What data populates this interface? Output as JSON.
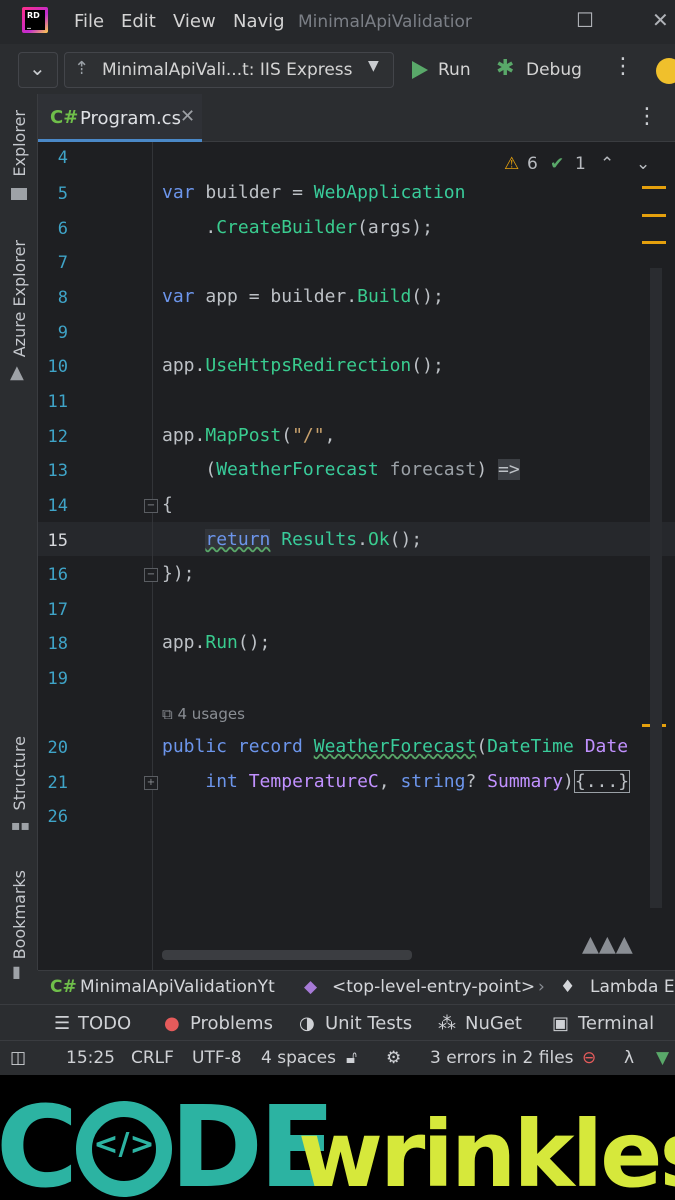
{
  "menu": {
    "file": "File",
    "edit": "Edit",
    "view": "View",
    "navigate": "Navig",
    "window_title": "MinimalApiValidatior"
  },
  "toolbar": {
    "config": "MinimalApiVali...t: IIS Express",
    "run": "Run",
    "debug": "Debug"
  },
  "left_tools": {
    "explorer": "Explorer",
    "azure": "Azure Explorer",
    "structure": "Structure",
    "bookmarks": "Bookmarks"
  },
  "tab": {
    "lang": "C#",
    "file": "Program.cs"
  },
  "inspections": {
    "warnings": "6",
    "ok": "1"
  },
  "code_lines": [
    {
      "n": "4"
    },
    {
      "n": "5"
    },
    {
      "n": "6"
    },
    {
      "n": "7"
    },
    {
      "n": "8"
    },
    {
      "n": "9"
    },
    {
      "n": "10"
    },
    {
      "n": "11"
    },
    {
      "n": "12"
    },
    {
      "n": "13"
    },
    {
      "n": "14"
    },
    {
      "n": "15"
    },
    {
      "n": "16"
    },
    {
      "n": "17"
    },
    {
      "n": "18"
    },
    {
      "n": "19"
    },
    {
      "n": "20"
    },
    {
      "n": "21"
    },
    {
      "n": "26"
    }
  ],
  "code": {
    "l5": [
      "var",
      "builder",
      "=",
      "WebApplication"
    ],
    "l6": [
      ".",
      "CreateBuilder",
      "(args);"
    ],
    "l8": [
      "var",
      "app",
      "=",
      "builder",
      ".",
      "Build",
      "();"
    ],
    "l10": [
      "app",
      ".",
      "UseHttpsRedirection",
      "();"
    ],
    "l12": [
      "app",
      ".",
      "MapPost",
      "(",
      "\"/\"",
      ","
    ],
    "l13": [
      "(",
      "WeatherForecast",
      "forecast",
      ")",
      "=>"
    ],
    "l14": [
      "{"
    ],
    "l15": [
      "return",
      "Results",
      ".",
      "Ok",
      "();"
    ],
    "l16": [
      "});"
    ],
    "l18": [
      "app",
      ".",
      "Run",
      "();"
    ],
    "usages": "4 usages",
    "l20": [
      "public",
      "record",
      "WeatherForecast",
      "(",
      "DateTime",
      "Date"
    ],
    "l21": [
      "int",
      "TemperatureC",
      ",",
      "string",
      "?",
      "Summary",
      ")",
      "{...}"
    ]
  },
  "breadcrumbs": {
    "project": "MinimalApiValidationYt",
    "entry": "<top-level-entry-point>",
    "lambda": "Lambda E"
  },
  "tool_windows": {
    "todo": "TODO",
    "problems": "Problems",
    "unit_tests": "Unit Tests",
    "nuget": "NuGet",
    "terminal": "Terminal"
  },
  "status": {
    "position": "15:25",
    "line_sep": "CRLF",
    "encoding": "UTF-8",
    "indent": "4 spaces",
    "errors": "3 errors in 2 files"
  },
  "brand": {
    "part1": "C",
    "part2": "DE",
    "part3": "wrinkles",
    "code_glyph": "</>"
  }
}
